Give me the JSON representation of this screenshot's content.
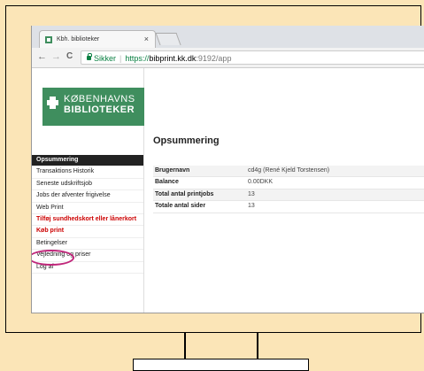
{
  "browser": {
    "tab_title": "Kbh. biblioteker",
    "tab_close": "×",
    "back": "←",
    "forward": "→",
    "reload": "C",
    "secure_label": "Sikker",
    "url_scheme": "https://",
    "url_host": "bibprint.kk.dk",
    "url_path": ":9192/app"
  },
  "logo": {
    "line1": "KØBENHAVNS",
    "line2": "BIBLIOTEKER"
  },
  "menu": {
    "items": [
      "Opsummering",
      "Transaktions Historik",
      "Seneste udskriftsjob",
      "Jobs der afventer frigivelse",
      "Web Print",
      "Tilføj sundhedskort eller lånerkort",
      "Køb print",
      "Betingelser",
      "Vejledning og priser",
      "Log af"
    ]
  },
  "main": {
    "heading": "Opsummering",
    "rows": [
      {
        "label": "Brugernavn",
        "value": "cd4g (René Kjeld Torstensen)"
      },
      {
        "label": "Balance",
        "value": "0.00DKK"
      },
      {
        "label": "Total antal printjobs",
        "value": "13"
      },
      {
        "label": "Totale antal sider",
        "value": "13"
      }
    ]
  },
  "colors": {
    "background": "#fbe5b7",
    "logo_green": "#3f8e5e",
    "highlight_circle": "#c0267a",
    "red_link": "#cc0000"
  }
}
